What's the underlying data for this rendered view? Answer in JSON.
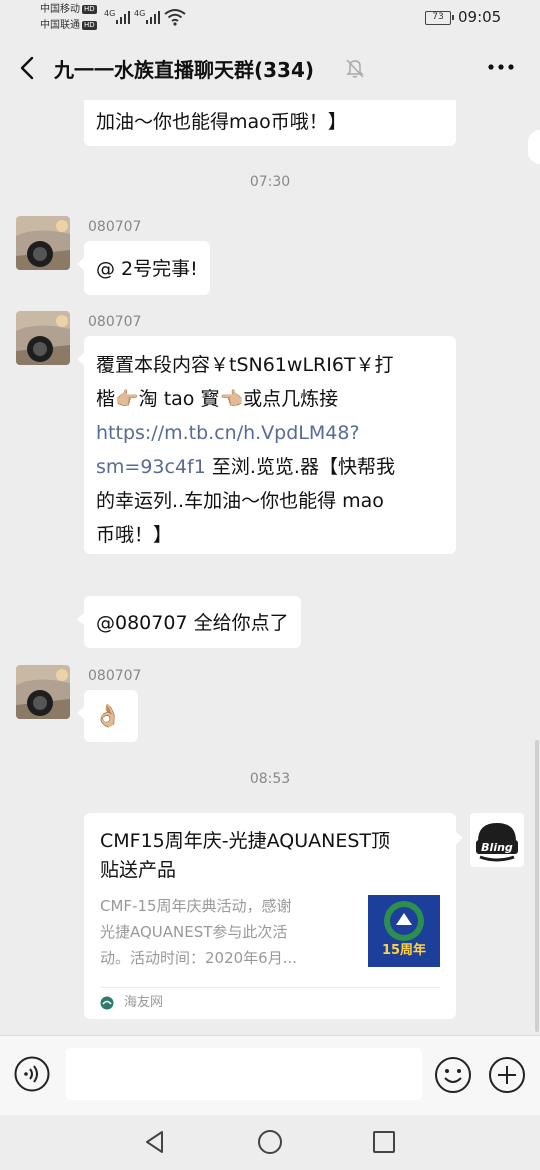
{
  "status_bar": {
    "carrier1": "中国移动",
    "carrier2": "中国联通",
    "hd": "HD",
    "net1": "4G",
    "net2": "4G",
    "battery": "73",
    "clock": "09:05"
  },
  "header": {
    "title": "九一一水族直播聊天群(334)"
  },
  "messages": {
    "m0_text": "加油～你也能得mao币哦！】",
    "time1": "07:30",
    "m1_sender": "080707",
    "m1_text": "@ 2号完事!",
    "m2_sender": "080707",
    "m2_line1": "覆置本段内容￥tSN61wLRI6T￥打",
    "m2_line2": "楷👉🏼淘 tao 寳👈🏼或点几炼接",
    "m2_link": "https://m.tb.cn/h.VpdLM48?sm=93c4f1",
    "m2_link1": "https://m.tb.cn/h.VpdLM48?",
    "m2_link2": "sm=93c4f1",
    "m2_line3_rest": " 至浏.览览.器【快帮我",
    "m2_line4": "的幸运列..车加油～你也能得 mao",
    "m2_line5": "币哦！】",
    "m3_text": "@080707  全给你点了",
    "m4_sender": "080707",
    "m4_emoji": "👌🏼",
    "time2": "08:53"
  },
  "card": {
    "title_line1": "CMF15周年庆-光捷AQUANEST顶",
    "title_line2": "贴送产品",
    "desc_line1": "CMF-15周年庆典活动，感谢",
    "desc_line2": "光捷AQUANEST参与此次活",
    "desc_line3": "动。活动时间：2020年6月...",
    "thumb_text": "15周年",
    "source": "海友网"
  },
  "right_avatar_text": "Bling",
  "input": {
    "placeholder": ""
  },
  "colors": {
    "background": "#ededed",
    "link": "#576b95",
    "bubble": "#ffffff"
  }
}
